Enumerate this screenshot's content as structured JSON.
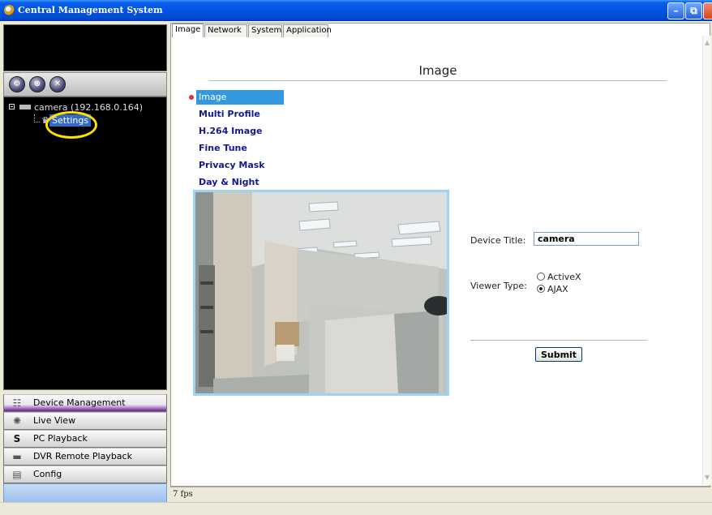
{
  "window": {
    "title": "Central Management System",
    "controls": {
      "minimize": "minimize-icon",
      "maximize": "maximize-icon",
      "close": "close-icon"
    }
  },
  "left_panel": {
    "tool_icons": [
      "connect-icon",
      "disconnect-icon",
      "delete-icon"
    ],
    "tree": {
      "device_label": "camera (192.168.0.164)",
      "child_label": "Settings"
    },
    "nav": [
      {
        "label": "Device Management",
        "icon": "device-management-icon",
        "active": true
      },
      {
        "label": "Live View",
        "icon": "live-view-icon",
        "active": false
      },
      {
        "label": "PC Playback",
        "icon": "pc-playback-icon",
        "active": false
      },
      {
        "label": "DVR Remote Playback",
        "icon": "dvr-remote-playback-icon",
        "active": false
      },
      {
        "label": "Config",
        "icon": "config-icon",
        "active": false
      }
    ]
  },
  "tabs": [
    "Image",
    "Network",
    "System",
    "Application"
  ],
  "active_tab": "Image",
  "content": {
    "page_title": "Image",
    "menu": [
      {
        "label": "Image",
        "active": true
      },
      {
        "label": "Multi Profile",
        "active": false
      },
      {
        "label": "H.264 Image",
        "active": false
      },
      {
        "label": "Fine Tune",
        "active": false
      },
      {
        "label": "Privacy Mask",
        "active": false
      },
      {
        "label": "Day & Night",
        "active": false
      }
    ],
    "form": {
      "device_title_label": "Device Title:",
      "device_title_value": "camera",
      "viewer_type_label": "Viewer Type:",
      "viewer_options": [
        {
          "label": "ActiveX",
          "checked": false
        },
        {
          "label": "AJAX",
          "checked": true
        }
      ],
      "submit_label": "Submit"
    }
  },
  "status": {
    "fps": "7 fps"
  },
  "colors": {
    "titlebar": "#0054e3",
    "menu_active": "#3298e0",
    "menu_link": "#17178c",
    "nav_active": "#8b3fa8",
    "highlight_ring": "#ffe000"
  }
}
